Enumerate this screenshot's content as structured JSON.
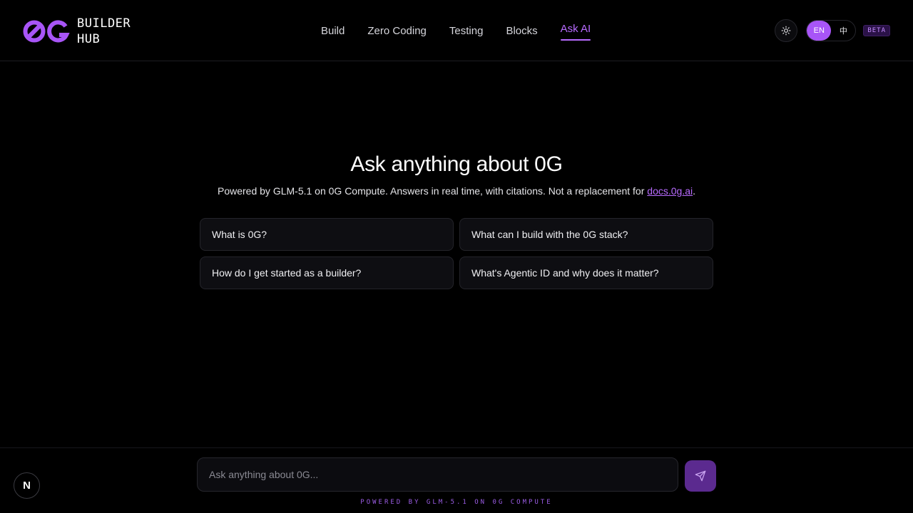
{
  "brand": {
    "line1": "BUILDER",
    "line2": "HUB",
    "logo_text": "0G",
    "accent": "#a855f7"
  },
  "nav": {
    "items": [
      {
        "label": "Build",
        "active": false
      },
      {
        "label": "Zero Coding",
        "active": false
      },
      {
        "label": "Testing",
        "active": false
      },
      {
        "label": "Blocks",
        "active": false
      },
      {
        "label": "Ask AI",
        "active": true
      }
    ]
  },
  "controls": {
    "theme_icon": "sun-icon",
    "lang_en": "EN",
    "lang_zh": "中",
    "lang_selected": "EN",
    "beta": "BETA"
  },
  "hero": {
    "title": "Ask anything about 0G",
    "subtitle_prefix": "Powered by GLM-5.1 on 0G Compute. Answers in real time, with citations. Not a replacement for ",
    "link": "docs.0g.ai",
    "subtitle_suffix": "."
  },
  "suggestions": [
    "What is 0G?",
    "What can I build with the 0G stack?",
    "How do I get started as a builder?",
    "What's Agentic ID and why does it matter?"
  ],
  "composer": {
    "placeholder": "Ask anything about 0G...",
    "value": "",
    "send_icon": "send-icon",
    "powered": "POWERED BY GLM-5.1 ON 0G COMPUTE"
  },
  "corner_badge": "N"
}
